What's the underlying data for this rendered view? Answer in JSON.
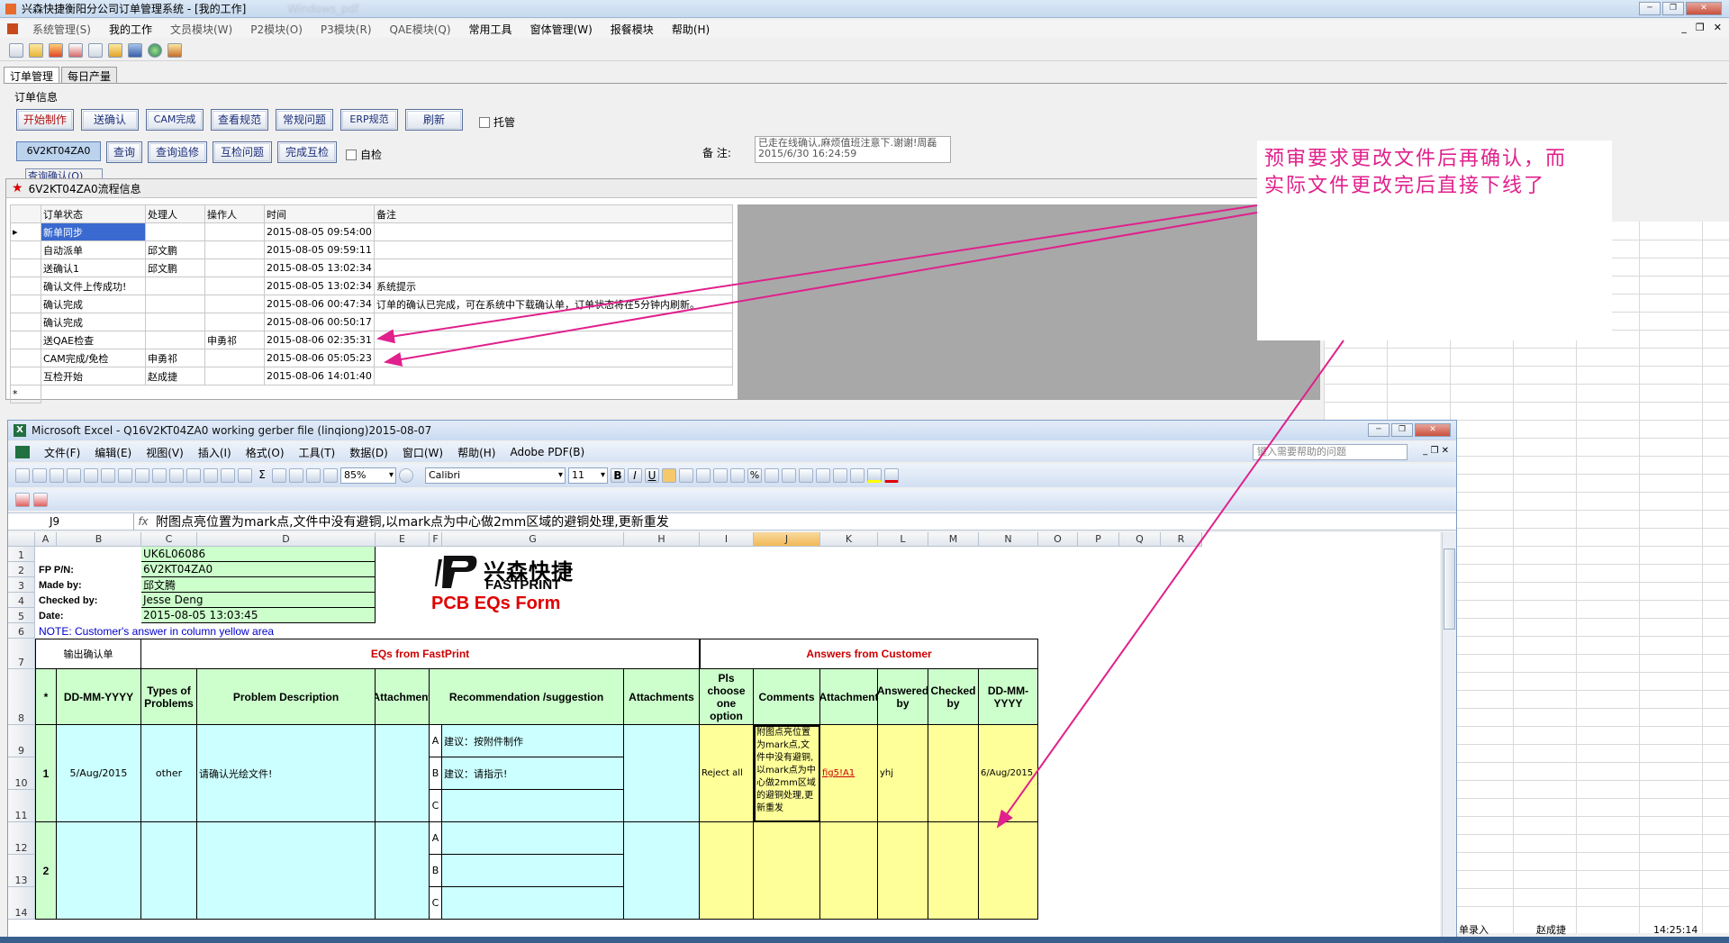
{
  "window": {
    "title": "兴森快捷衡阳分公司订单管理系统 - [我的工作]",
    "blurred_title": "Windows_pdf"
  },
  "menu": [
    "系统管理(S)",
    "我的工作",
    "文员模块(W)",
    "P2模块(O)",
    "P3模块(R)",
    "QAE模块(Q)",
    "常用工具",
    "窗体管理(W)",
    "报餐模块",
    "帮助(H)"
  ],
  "tabs": [
    "订单管理",
    "每日产量"
  ],
  "order_info": {
    "group_label": "订单信息",
    "buttons_row1": [
      "开始制作",
      "送确认",
      "CAM完成",
      "查看规范",
      "常规问题",
      "ERP规范",
      "刷新"
    ],
    "checkbox_tuoguan": "托管",
    "order_no": "6V2KT04ZA0",
    "buttons_row2": [
      "查询",
      "查询追修",
      "互检问题",
      "完成互检"
    ],
    "checkbox_zijian": "自检",
    "remark_label": "备  注:",
    "remark_text": "已走在线确认,麻烦值班注意下.谢谢!周磊2015/6/30 16:24:59",
    "clipped_button": "查询确认(Q)"
  },
  "flow": {
    "title": "6V2KT04ZA0流程信息",
    "columns": [
      "订单状态",
      "处理人",
      "操作人",
      "时间",
      "备注"
    ],
    "rows": [
      [
        "新单同步",
        "",
        "",
        "2015-08-05 09:54:00",
        ""
      ],
      [
        "自动派单",
        "邱文鹏",
        "",
        "2015-08-05 09:59:11",
        ""
      ],
      [
        "送确认1",
        "邱文鹏",
        "",
        "2015-08-05 13:02:34",
        ""
      ],
      [
        "确认文件上传成功!",
        "",
        "",
        "2015-08-05 13:02:34",
        "系统提示"
      ],
      [
        "确认完成",
        "",
        "",
        "2015-08-06 00:47:34",
        "订单的确认已完成，可在系统中下载确认单，订单状态将在5分钟内刷新。"
      ],
      [
        "确认完成",
        "",
        "",
        "2015-08-06 00:50:17",
        ""
      ],
      [
        "送QAE检查",
        "",
        "申勇祁",
        "2015-08-06 02:35:31",
        ""
      ],
      [
        "CAM完成/免检",
        "申勇祁",
        "",
        "2015-08-06 05:05:23",
        ""
      ],
      [
        "互检开始",
        "赵成捷",
        "",
        "2015-08-06 14:01:40",
        ""
      ]
    ],
    "new_row_marker": "*"
  },
  "annotation": {
    "line1": "预审要求更改文件后再确认，而",
    "line2": "实际文件更改完后直接下线了"
  },
  "excel": {
    "title": "Microsoft Excel - Q16V2KT04ZA0 working gerber file (linqiong)2015-08-07",
    "menu": [
      "文件(F)",
      "编辑(E)",
      "视图(V)",
      "插入(I)",
      "格式(O)",
      "工具(T)",
      "数据(D)",
      "窗口(W)",
      "帮助(H)",
      "Adobe PDF(B)"
    ],
    "help_placeholder": "键入需要帮助的问题",
    "zoom": "85%",
    "font": "Calibri",
    "font_size": "11",
    "name_box": "J9",
    "fx": "fx",
    "formula": "附图点亮位置为mark点,文件中没有避铜,以mark点为中心做2mm区域的避铜处理,更新重发",
    "columns": [
      "A",
      "B",
      "C",
      "D",
      "E",
      "F",
      "G",
      "H",
      "I",
      "J",
      "K",
      "L",
      "M",
      "N",
      "O",
      "P",
      "Q",
      "R"
    ],
    "selected_column": "J",
    "rows": [
      "1",
      "2",
      "3",
      "4",
      "5",
      "6",
      "7",
      "8",
      "9",
      "10",
      "11",
      "12",
      "13",
      "14"
    ],
    "header": {
      "customer_code": "UK6L06086",
      "fp_pn_label": "FP P/N:",
      "fp_pn": "6V2KT04ZA0",
      "made_by_label": "Made by:",
      "made_by": "邱文腾",
      "checked_by_label": "Checked by:",
      "checked_by": "Jesse Deng",
      "date_label": "Date:",
      "date": "2015-08-05 13:03:45",
      "note": "NOTE: Customer's  answer in column yellow area"
    },
    "logo": {
      "cn": "兴森快捷",
      "en": "FASTPRINT",
      "form": "PCB EQs Form"
    },
    "section": {
      "export_btn": "输出确认单",
      "left": "EQs from FastPrint",
      "right": "Answers from Customer"
    },
    "col_headers": {
      "star": "*",
      "date": "DD-MM-YYYY",
      "types": "Types of Problems",
      "problem": "Problem Description",
      "attachment": "Attachment",
      "recommend": "Recommendation /suggestion",
      "attachments": "Attachments",
      "choose": "Pls choose one option",
      "comments": "Comments",
      "attachment2": "Attachment",
      "answered": "Answered by",
      "checked": "Checked by",
      "date2": "DD-MM-YYYY"
    },
    "eq1": {
      "no": "1",
      "date": "5/Aug/2015",
      "type": "other",
      "problem": "请确认光绘文件!",
      "opt_a": "A",
      "sug_a": "建议：按附件制作",
      "opt_b": "B",
      "sug_b": "建议：请指示!",
      "opt_c": "C",
      "choice": "Reject all",
      "comment": "附图点亮位置为mark点,文件中没有避铜,以mark点为中心做2mm区域的避铜处理,更新重发",
      "attachment": "fig5!A1",
      "answered_by": "yhj",
      "answer_date": "6/Aug/2015"
    },
    "eq2": {
      "no": "2",
      "opt_a": "A",
      "opt_b": "B",
      "opt_c": "C"
    }
  },
  "statusbar": {
    "user_fragment": "单录入",
    "user": "赵成捷",
    "time": "14:25:14"
  },
  "colors": {
    "pink": "#e0208c",
    "green_cell": "#ccffcc",
    "cyan_cell": "#ccffff",
    "yellow_cell": "#ffff99",
    "header_red": "#cc0000"
  }
}
